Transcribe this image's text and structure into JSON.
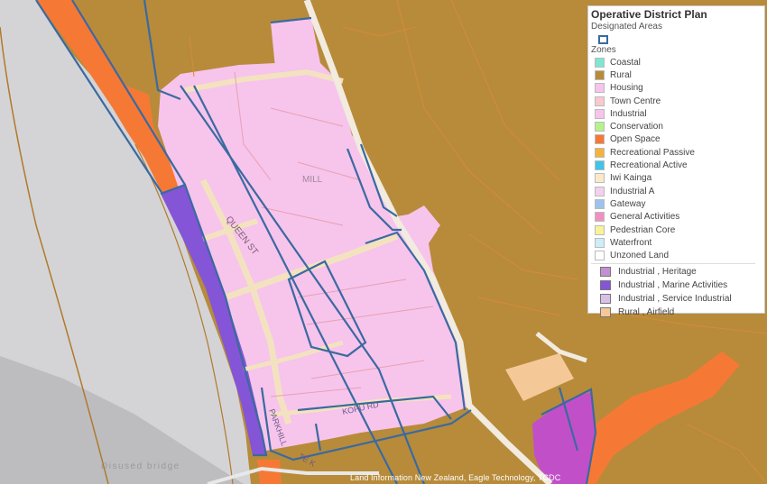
{
  "map": {
    "labels": {
      "queen_st": "QUEEN ST",
      "mill": "MILL",
      "kopu_rd": "KOPU RD",
      "te_k": "TE K",
      "parkhill": "PARKHILL",
      "disused_bridge": "Disused bridge"
    },
    "attribution": "Land Information New Zealand, Eagle Technology, TCDC"
  },
  "legend": {
    "title": "Operative District Plan",
    "designated_label": "Designated Areas",
    "zones_label": "Zones",
    "zones": [
      {
        "label": "Coastal",
        "color": "#7fe6d2"
      },
      {
        "label": "Rural",
        "color": "#b78b3a"
      },
      {
        "label": "Housing",
        "color": "#f7c4ec"
      },
      {
        "label": "Town Centre",
        "color": "#f9c8d0"
      },
      {
        "label": "Industrial",
        "color": "#f7c4ec"
      },
      {
        "label": "Conservation",
        "color": "#b6f28a"
      },
      {
        "label": "Open Space",
        "color": "#f57935"
      },
      {
        "label": "Recreational Passive",
        "color": "#f5b23c"
      },
      {
        "label": "Recreational Active",
        "color": "#3fc4ea"
      },
      {
        "label": "Iwi Kainga",
        "color": "#fbe9c8"
      },
      {
        "label": "Industrial A",
        "color": "#f3d0ee"
      },
      {
        "label": "Gateway",
        "color": "#9dc3ec"
      },
      {
        "label": "General Activities",
        "color": "#f090c0"
      },
      {
        "label": "Pedestrian Core",
        "color": "#f7f39a"
      },
      {
        "label": "Waterfront",
        "color": "#cdeef7"
      },
      {
        "label": "Unzoned Land",
        "color": "#ffffff"
      }
    ],
    "combos": [
      {
        "label": "Industrial , Heritage",
        "color": "#c18fd2"
      },
      {
        "label": "Industrial , Marine Activities",
        "color": "#8455d6"
      },
      {
        "label": "Industrial , Service Industrial",
        "color": "#d9c0e8"
      },
      {
        "label": "Rural , Airfield",
        "color": "#f5c898"
      }
    ]
  }
}
